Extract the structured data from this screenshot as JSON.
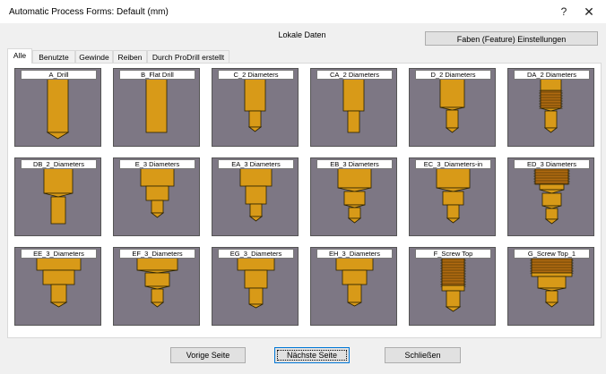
{
  "window": {
    "title": "Automatic Process Forms: Default (mm)",
    "help_glyph": "?",
    "close_glyph": "✕"
  },
  "header": {
    "section_label": "Lokale Daten",
    "feature_button": "Faben (Feature) Einstellungen"
  },
  "tabs": [
    {
      "label": "Alle",
      "active": true
    },
    {
      "label": "Benutzte"
    },
    {
      "label": "Gewinde"
    },
    {
      "label": "Reiben"
    },
    {
      "label": "Durch ProDrill erstellt"
    }
  ],
  "forms": [
    {
      "label": "A_Drill",
      "shape": "A"
    },
    {
      "label": "B_Flat Drill",
      "shape": "B"
    },
    {
      "label": "C_2 Diameters",
      "shape": "C"
    },
    {
      "label": "CA_2 Diameters",
      "shape": "CA"
    },
    {
      "label": "D_2 Diameters",
      "shape": "D"
    },
    {
      "label": "DA_2 Diameters",
      "shape": "DA"
    },
    {
      "label": "DB_2_Diameters",
      "shape": "DB"
    },
    {
      "label": "E_3 Diameters",
      "shape": "E"
    },
    {
      "label": "EA_3 Diameters",
      "shape": "EA"
    },
    {
      "label": "EB_3 Diameters",
      "shape": "EB"
    },
    {
      "label": "EC_3_Diameters-in",
      "shape": "EC"
    },
    {
      "label": "ED_3 Diameters",
      "shape": "ED"
    },
    {
      "label": "EE_3_Diameters",
      "shape": "EE"
    },
    {
      "label": "EF_3_Diameters",
      "shape": "EF"
    },
    {
      "label": "EG_3_Diameters",
      "shape": "EG"
    },
    {
      "label": "EH_3_Diameters",
      "shape": "EH"
    },
    {
      "label": "F_Screw Top",
      "shape": "F"
    },
    {
      "label": "G_Screw Top_1",
      "shape": "G"
    }
  ],
  "buttons": {
    "previous": "Vorige Seite",
    "next": "Nächste Seite",
    "close": "Schließen"
  },
  "colors": {
    "metal": "#d89a18",
    "outline": "#2a2200",
    "thread": "#b06a10",
    "card_bg": "#7d7784"
  }
}
